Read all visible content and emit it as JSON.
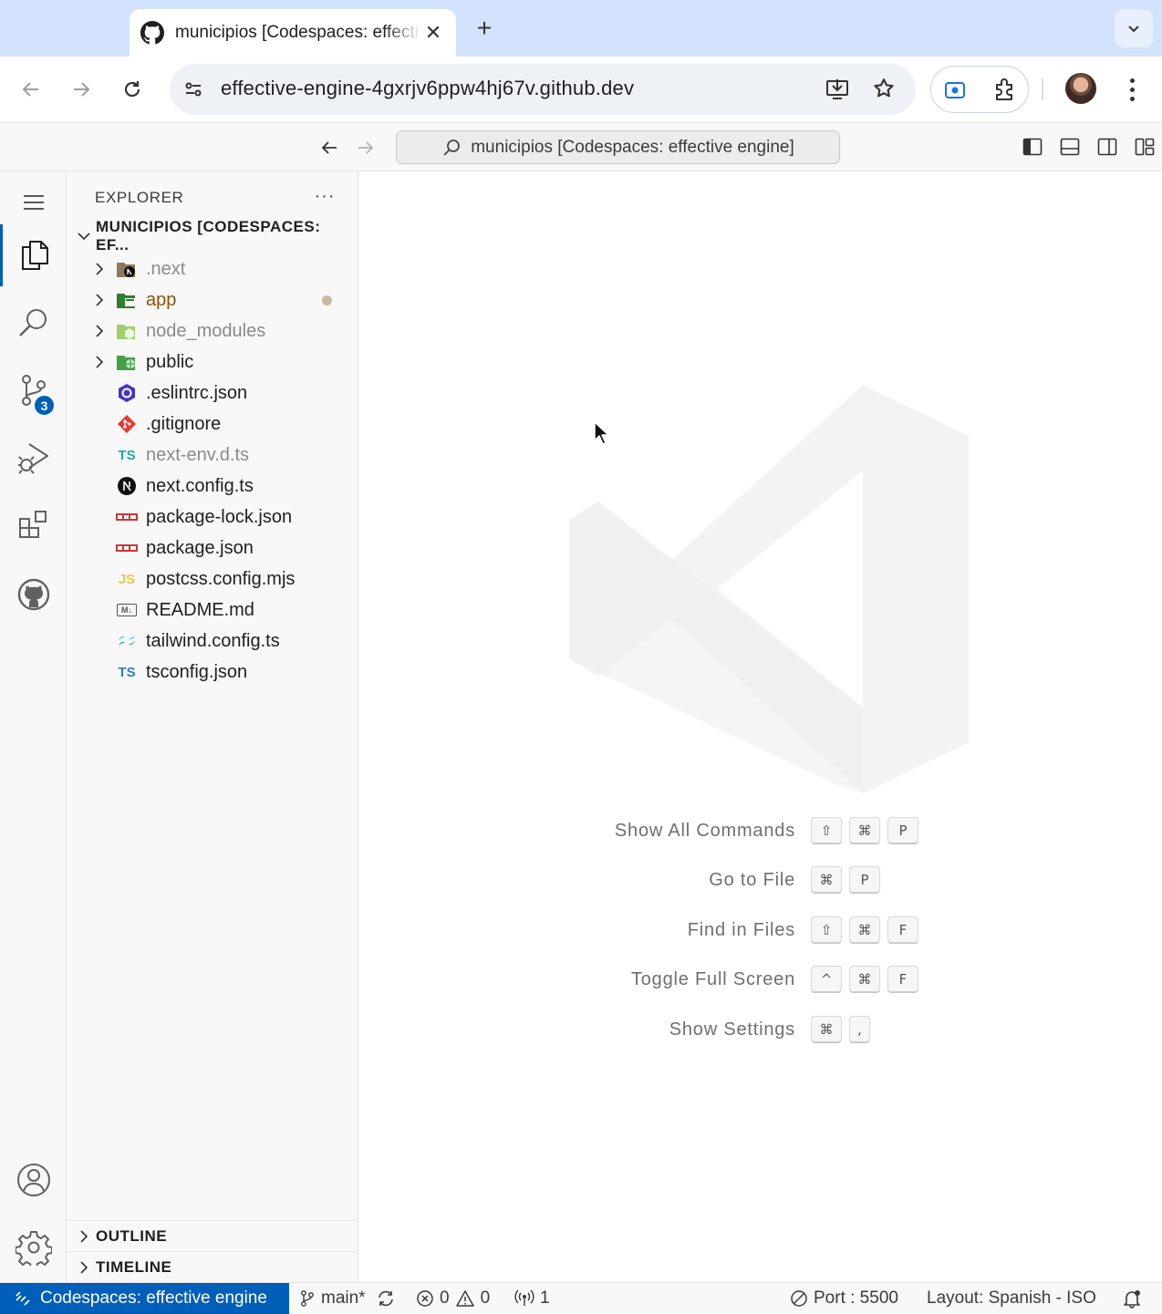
{
  "browser": {
    "tab_title": "municipios [Codespaces: effective engine]",
    "url": "effective-engine-4gxrjv6ppw4hj67v.github.dev",
    "icons": [
      "github-icon",
      "close-icon",
      "plus-icon",
      "chevron-down-icon",
      "back-icon",
      "forward-icon",
      "reload-icon",
      "site-settings-icon",
      "install-app-icon",
      "star-icon",
      "screen-record-icon",
      "extensions-icon",
      "profile-avatar",
      "more-icon"
    ]
  },
  "titlebar": {
    "command_center": "municipios [Codespaces: effective engine]"
  },
  "activity_bar": {
    "source_control_badge": "3",
    "items": [
      "menu",
      "explorer",
      "search",
      "source-control",
      "run-and-debug",
      "extensions",
      "github",
      "accounts",
      "manage"
    ]
  },
  "explorer": {
    "title": "EXPLORER",
    "more": "···",
    "root": "MUNICIPIOS [CODESPACES: EF...",
    "items": [
      {
        "name": ".next",
        "type": "folder",
        "dimmed": true
      },
      {
        "name": "app",
        "type": "folder",
        "modified": true
      },
      {
        "name": "node_modules",
        "type": "folder",
        "dimmed": true
      },
      {
        "name": "public",
        "type": "folder"
      },
      {
        "name": ".eslintrc.json",
        "type": "file"
      },
      {
        "name": ".gitignore",
        "type": "file"
      },
      {
        "name": "next-env.d.ts",
        "type": "file",
        "dimmed": true
      },
      {
        "name": "next.config.ts",
        "type": "file"
      },
      {
        "name": "package-lock.json",
        "type": "file"
      },
      {
        "name": "package.json",
        "type": "file"
      },
      {
        "name": "postcss.config.mjs",
        "type": "file"
      },
      {
        "name": "README.md",
        "type": "file"
      },
      {
        "name": "tailwind.config.ts",
        "type": "file"
      },
      {
        "name": "tsconfig.json",
        "type": "file"
      }
    ],
    "icon_texts": {
      "ts": "TS",
      "js": "JS",
      "md": "M↓"
    },
    "outline": "OUTLINE",
    "timeline": "TIMELINE"
  },
  "welcome": {
    "shortcuts": [
      {
        "label": "Show All Commands",
        "keys": [
          "⇧",
          "⌘",
          "P"
        ]
      },
      {
        "label": "Go to File",
        "keys": [
          "⌘",
          "P"
        ]
      },
      {
        "label": "Find in Files",
        "keys": [
          "⇧",
          "⌘",
          "F"
        ]
      },
      {
        "label": "Toggle Full Screen",
        "keys": [
          "^",
          "⌘",
          "F"
        ]
      },
      {
        "label": "Show Settings",
        "keys": [
          "⌘",
          ","
        ]
      }
    ]
  },
  "statusbar": {
    "remote": "Codespaces: effective engine",
    "branch": "main*",
    "errors": "0",
    "warnings": "0",
    "ports": "1",
    "port": "Port : 5500",
    "layout": "Layout: Spanish - ISO"
  },
  "colors": {
    "accent": "#005fb8",
    "tabstrip": "#d3e3fd",
    "modified_folder": "#895503"
  }
}
